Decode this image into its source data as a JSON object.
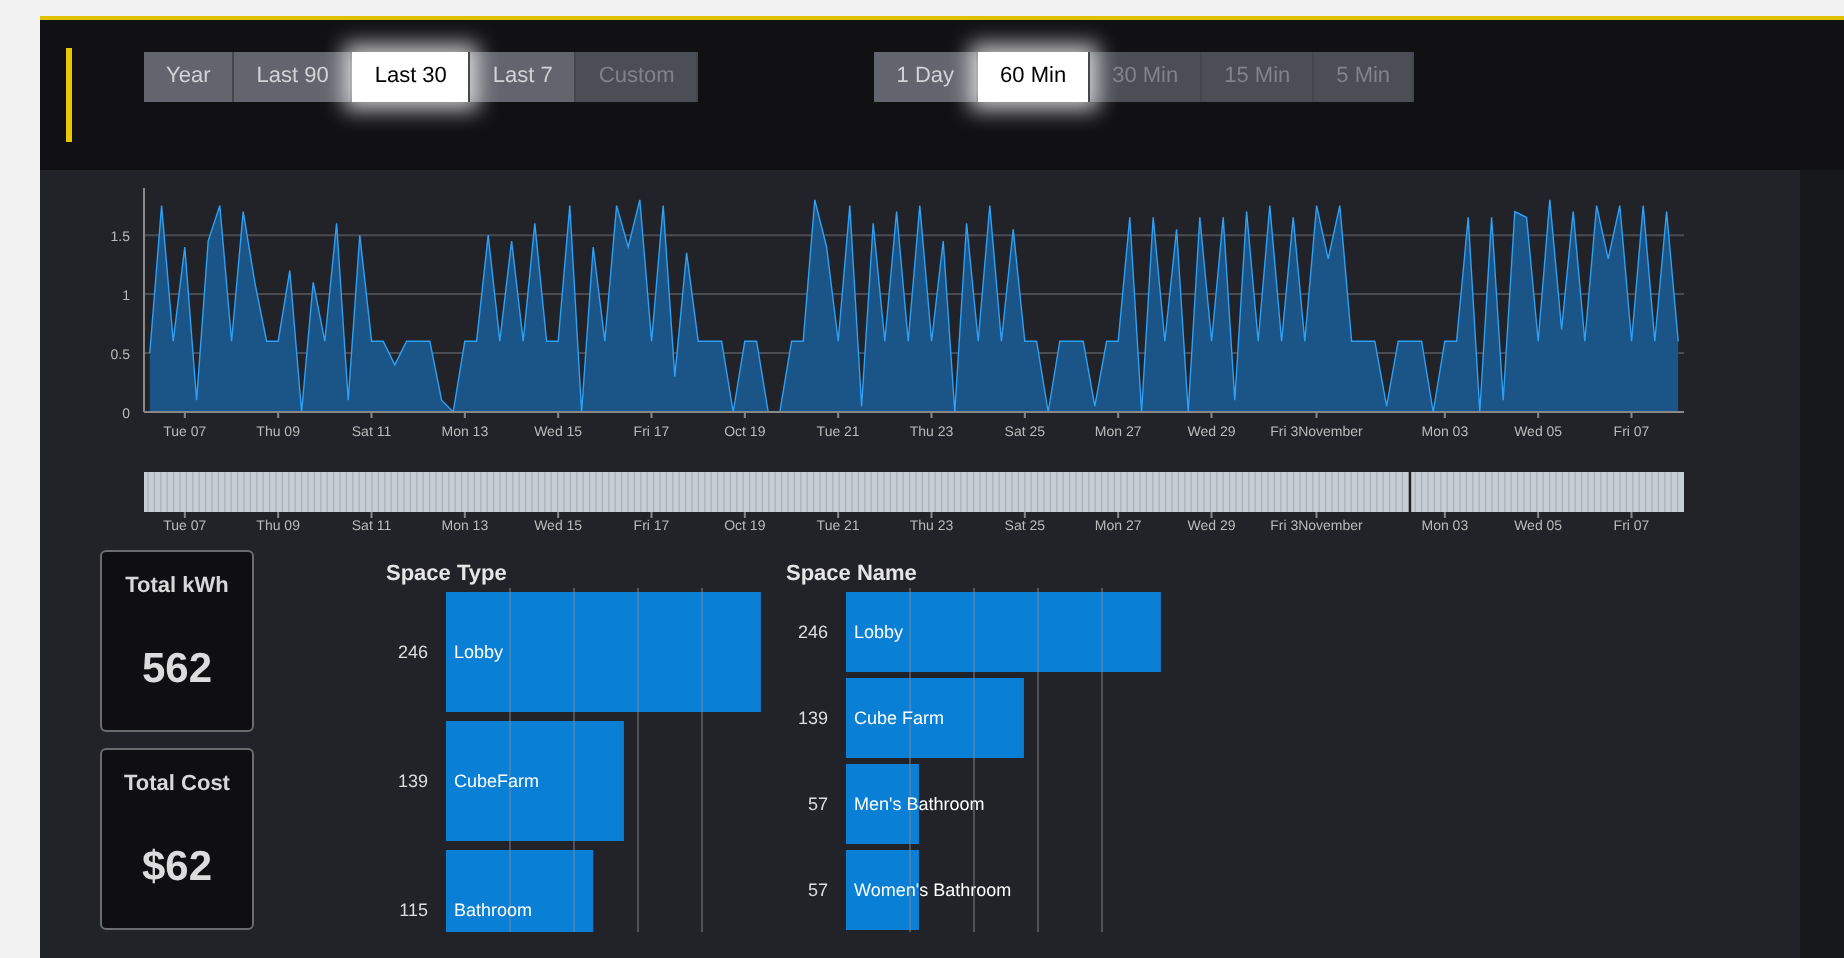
{
  "range_buttons": [
    {
      "label": "Year",
      "selected": false,
      "disabled": false
    },
    {
      "label": "Last 90",
      "selected": false,
      "disabled": false
    },
    {
      "label": "Last 30",
      "selected": true,
      "disabled": false
    },
    {
      "label": "Last 7",
      "selected": false,
      "disabled": false
    },
    {
      "label": "Custom",
      "selected": false,
      "disabled": true
    }
  ],
  "interval_buttons": [
    {
      "label": "1 Day",
      "selected": false,
      "disabled": false
    },
    {
      "label": "60 Min",
      "selected": true,
      "disabled": false
    },
    {
      "label": "30 Min",
      "selected": false,
      "disabled": true
    },
    {
      "label": "15 Min",
      "selected": false,
      "disabled": true
    },
    {
      "label": "5 Min",
      "selected": false,
      "disabled": true
    }
  ],
  "usage_chart": {
    "chart_data": {
      "type": "area",
      "grid": true,
      "ylim": [
        0,
        1.9
      ],
      "categories": [
        null,
        null,
        null,
        "Tue 07",
        null,
        null,
        null,
        null,
        null,
        null,
        null,
        "Thu 09",
        null,
        null,
        null,
        null,
        null,
        null,
        null,
        "Sat 11",
        null,
        null,
        null,
        null,
        null,
        null,
        null,
        "Mon 13",
        null,
        null,
        null,
        null,
        null,
        null,
        null,
        "Wed 15",
        null,
        null,
        null,
        null,
        null,
        null,
        null,
        "Fri 17",
        null,
        null,
        null,
        null,
        null,
        null,
        null,
        "Oct 19",
        null,
        null,
        null,
        null,
        null,
        null,
        null,
        "Tue 21",
        null,
        null,
        null,
        null,
        null,
        null,
        null,
        "Thu 23",
        null,
        null,
        null,
        null,
        null,
        null,
        null,
        "Sat 25",
        null,
        null,
        null,
        null,
        null,
        null,
        null,
        "Mon 27",
        null,
        null,
        null,
        null,
        null,
        null,
        null,
        "Wed 29",
        null,
        null,
        null,
        null,
        null,
        null,
        null,
        null,
        "Fri 3November",
        null,
        null,
        null,
        null,
        null,
        null,
        null,
        null,
        null,
        null,
        "Mon 03",
        null,
        null,
        null,
        null,
        null,
        null,
        null,
        "Wed 05",
        null,
        null,
        null,
        null,
        null,
        null,
        null,
        "Fri 07",
        null,
        null,
        null,
        null
      ],
      "values": [
        0.5,
        1.75,
        0.6,
        1.4,
        0.1,
        1.45,
        1.75,
        0.6,
        1.7,
        1.1,
        0.6,
        0.6,
        1.2,
        0,
        1.1,
        0.6,
        1.6,
        0.1,
        1.5,
        0.6,
        0.6,
        0.4,
        0.6,
        0.6,
        0.6,
        0.1,
        0,
        0.6,
        0.6,
        1.5,
        0.6,
        1.45,
        0.6,
        1.6,
        0.6,
        0.6,
        1.75,
        0,
        1.4,
        0.6,
        1.75,
        1.4,
        1.8,
        0.6,
        1.75,
        0.3,
        1.35,
        0.6,
        0.6,
        0.6,
        0,
        0.6,
        0.6,
        0,
        0,
        0.6,
        0.6,
        1.8,
        1.4,
        0.6,
        1.75,
        0.05,
        1.6,
        0.6,
        1.7,
        0.6,
        1.75,
        0.6,
        1.45,
        0,
        1.6,
        0.6,
        1.75,
        0.6,
        1.55,
        0.6,
        0.6,
        0,
        0.6,
        0.6,
        0.6,
        0.05,
        0.6,
        0.6,
        1.65,
        0,
        1.65,
        0.6,
        1.55,
        0,
        1.65,
        0.6,
        1.65,
        0.1,
        1.7,
        0.6,
        1.75,
        0.6,
        1.65,
        0.6,
        1.75,
        1.3,
        1.75,
        0.6,
        0.6,
        0.6,
        0.05,
        0.6,
        0.6,
        0.6,
        0,
        0.6,
        0.6,
        1.65,
        0,
        1.65,
        0.1,
        1.7,
        1.65,
        0.6,
        1.8,
        0.7,
        1.7,
        0.6,
        1.75,
        1.3,
        1.75,
        0.6,
        1.75,
        0.6,
        1.7,
        0.6
      ],
      "yticks": [
        {
          "value": 0,
          "label": "0"
        },
        {
          "value": 0.5,
          "label": "0.5"
        },
        {
          "value": 1,
          "label": "1"
        },
        {
          "value": 1.5,
          "label": "1.5"
        }
      ]
    }
  },
  "navigator": {
    "labels": [
      "Tue 07",
      "Thu 09",
      "Sat 11",
      "Mon 13",
      "Wed 15",
      "Fri 17",
      "Oct 19",
      "Tue 21",
      "Thu 23",
      "Sat 25",
      "Mon 27",
      "Wed 29",
      "Fri 3November",
      "Mon 03",
      "Wed 05",
      "Fri 07"
    ]
  },
  "totals": [
    {
      "label": "Total kWh",
      "value": "562"
    },
    {
      "label": "Total Cost",
      "value": "$62"
    }
  ],
  "space_type": {
    "chart_data": {
      "type": "bar",
      "orientation": "horizontal",
      "title": "Space Type",
      "categories": [
        "Lobby",
        "CubeFarm",
        "Bathroom"
      ],
      "values": [
        246,
        139,
        115
      ],
      "data_labels": true
    }
  },
  "space_name": {
    "chart_data": {
      "type": "bar",
      "orientation": "horizontal",
      "title": "Space Name",
      "categories": [
        "Lobby",
        "Cube Farm",
        "Men's Bathroom",
        "Women's Bathroom"
      ],
      "values": [
        246,
        139,
        57,
        57
      ],
      "data_labels": true
    }
  }
}
